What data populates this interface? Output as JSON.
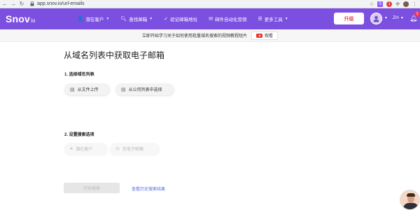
{
  "browser": {
    "url": "app.snov.io/url-emails",
    "ext_s_label": "S",
    "ext_r_label": "1"
  },
  "header": {
    "logo": "Snov",
    "logo_suffix": "io",
    "menu": [
      {
        "label": "潜在客户",
        "icon": "users-icon"
      },
      {
        "label": "查找邮箱",
        "icon": "search-icon"
      },
      {
        "label": "验证邮箱地址",
        "icon": "check-circle-icon"
      },
      {
        "label": "邮件自动化营销",
        "icon": "mail-icon"
      },
      {
        "label": "更多工具",
        "icon": "list-icon"
      }
    ],
    "upgrade_label": "升级",
    "language": "ZH",
    "notification_count": "1",
    "accent_color": "#7b4fe0",
    "upgrade_color": "#e84a5f"
  },
  "promo": {
    "text": "立即开始学习关于如何使用批量域名搜索的视频教程短片",
    "watch_label": "观看"
  },
  "main": {
    "title": "从域名列表中获取电子邮箱",
    "section1_label": "1. 选择域名列表",
    "upload_file_label": "从文件上传",
    "company_list_label": "从公司列表中选择",
    "section2_label": "2. 设置搜索选项",
    "prospects_label": "潜在客户",
    "email_only_label": "仅电子邮箱",
    "start_label": "开始搜索",
    "history_label": "查看历史搜索结果",
    "link_color": "#5b6ee1"
  }
}
